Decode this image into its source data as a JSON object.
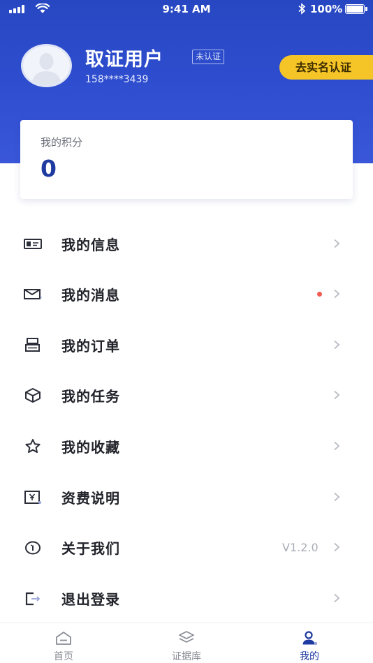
{
  "status_bar": {
    "time": "9:41 AM",
    "battery": "100%"
  },
  "profile": {
    "name": "取证用户",
    "verify_status": "未认证",
    "phone": "158****3439",
    "realname_button": "去实名认证"
  },
  "points": {
    "label": "我的积分",
    "value": "0"
  },
  "menu": {
    "items": [
      {
        "label": "我的信息",
        "icon": "id-card-icon"
      },
      {
        "label": "我的消息",
        "icon": "mail-icon",
        "badge_dot": true
      },
      {
        "label": "我的订单",
        "icon": "order-icon"
      },
      {
        "label": "我的任务",
        "icon": "cube-icon"
      },
      {
        "label": "我的收藏",
        "icon": "star-icon"
      },
      {
        "label": "资费说明",
        "icon": "fee-icon"
      },
      {
        "label": "关于我们",
        "icon": "info-icon",
        "value": "V1.2.0"
      },
      {
        "label": "退出登录",
        "icon": "logout-icon"
      }
    ]
  },
  "tab_bar": {
    "tabs": [
      {
        "label": "首页",
        "icon": "home-icon",
        "active": false
      },
      {
        "label": "证据库",
        "icon": "layers-icon",
        "active": false
      },
      {
        "label": "我的",
        "icon": "user-icon",
        "active": true
      }
    ]
  },
  "colors": {
    "primary": "#2747c2",
    "accent": "#f5c527",
    "badge_dot": "#f25a52",
    "active_tab": "#1f3aa0"
  }
}
